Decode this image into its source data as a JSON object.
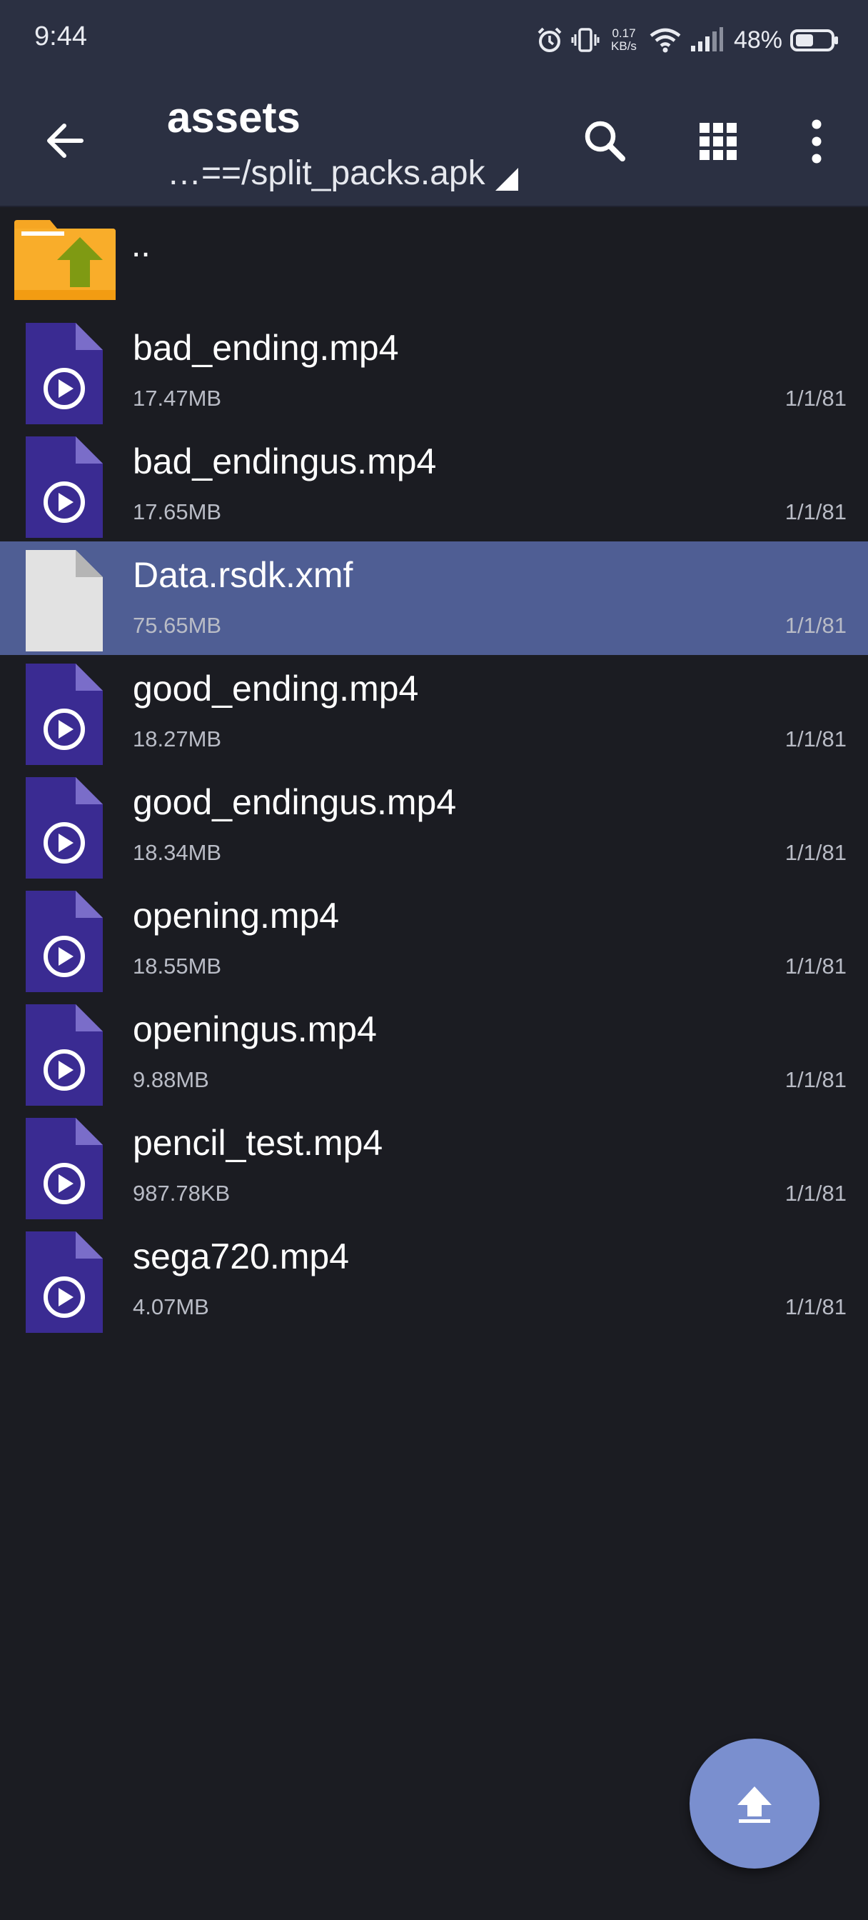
{
  "status_bar": {
    "time": "9:44",
    "net_speed_value": "0.17",
    "net_speed_unit": "KB/s",
    "battery_percent": "48%"
  },
  "toolbar": {
    "title": "assets",
    "subtitle": "…==/split_packs.apk",
    "icons": [
      "back-arrow-icon",
      "search-icon",
      "grid-view-icon",
      "more-vert-icon"
    ]
  },
  "parent_entry": {
    "label": ".."
  },
  "files": [
    {
      "name": "bad_ending.mp4",
      "size": "17.47MB",
      "date": "1/1/81",
      "type": "video"
    },
    {
      "name": "bad_endingus.mp4",
      "size": "17.65MB",
      "date": "1/1/81",
      "type": "video"
    },
    {
      "name": "Data.rsdk.xmf",
      "size": "75.65MB",
      "date": "1/1/81",
      "type": "generic",
      "selected": true
    },
    {
      "name": "good_ending.mp4",
      "size": "18.27MB",
      "date": "1/1/81",
      "type": "video"
    },
    {
      "name": "good_endingus.mp4",
      "size": "18.34MB",
      "date": "1/1/81",
      "type": "video"
    },
    {
      "name": "opening.mp4",
      "size": "18.55MB",
      "date": "1/1/81",
      "type": "video"
    },
    {
      "name": "openingus.mp4",
      "size": "9.88MB",
      "date": "1/1/81",
      "type": "video"
    },
    {
      "name": "pencil_test.mp4",
      "size": "987.78KB",
      "date": "1/1/81",
      "type": "video"
    },
    {
      "name": "sega720.mp4",
      "size": "4.07MB",
      "date": "1/1/81",
      "type": "video"
    }
  ],
  "colors": {
    "toolbar_bg": "#2b3042",
    "list_bg": "#1b1c22",
    "selected_row": "#4f5e94",
    "video_icon": "#3a2b92",
    "fab": "#7a8fcf"
  }
}
